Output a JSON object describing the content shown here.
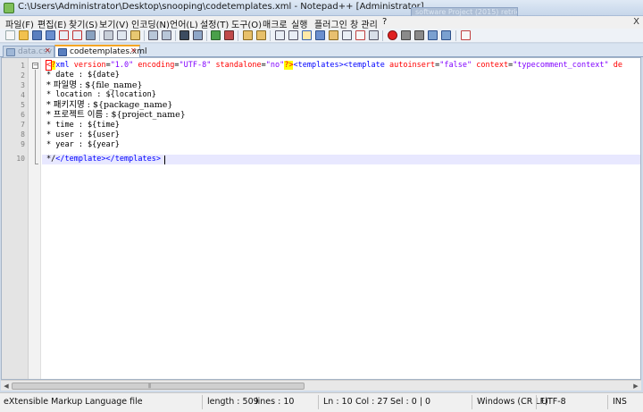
{
  "window": {
    "title": "C:\\Users\\Administrator\\Desktop\\snooping\\codetemplates.xml - Notepad++ [Administrator]",
    "background_snippet": "software Project (2015) retrieve..."
  },
  "menu": [
    "파일(F)",
    "편집(E)",
    "찾기(S)",
    "보기(V)",
    "인코딩(N)",
    "언어(L)",
    "설정(T)",
    "도구(O)",
    "매크로",
    "실행",
    "플러그인",
    "창 관리",
    "?"
  ],
  "menu_close": "X",
  "tabs": [
    {
      "label": "data.csv",
      "active": false
    },
    {
      "label": "codetemplates.xml",
      "active": true
    }
  ],
  "editor": {
    "line_numbers": [
      "1",
      "2",
      "3",
      "4",
      "5",
      "6",
      "7",
      "8",
      "9",
      "10"
    ],
    "line1": {
      "open": "<",
      "pi_start": "?",
      "decl": "xml",
      "attr1": "version",
      "val1": "\"1.0\"",
      "attr2": "encoding",
      "val2": "\"UTF-8\"",
      "attr3": "standalone",
      "val3": "\"no\"",
      "pi_end": "?>",
      "tag1": "<templates>",
      "tag2": "<template",
      "attr4": "autoinsert",
      "val4": "\"false\"",
      "attr5": "context",
      "val5": "\"typecomment_context\"",
      "attr6": "de"
    },
    "lines": [
      "* date : ${date}",
      "* 파일명 : ${file_name}",
      "* location : ${location}",
      "* 패키지명 : ${package_name}",
      "* 프로젝트 이름 : ${project_name}",
      "* time : ${time}",
      "* user : ${user}",
      "* year : ${year}"
    ],
    "line10": {
      "prefix": "*/",
      "close1": "</template>",
      "close2": "</templates>",
      "end": ">"
    }
  },
  "status": {
    "file_type": "eXtensible Markup Language file",
    "length": "length : 509",
    "lines": "lines : 10",
    "ln": "Ln : 10",
    "col": "Col : 27",
    "sel": "Sel : 0 | 0",
    "eol": "Windows (CR LF)",
    "encoding": "UTF-8",
    "mode": "INS"
  }
}
